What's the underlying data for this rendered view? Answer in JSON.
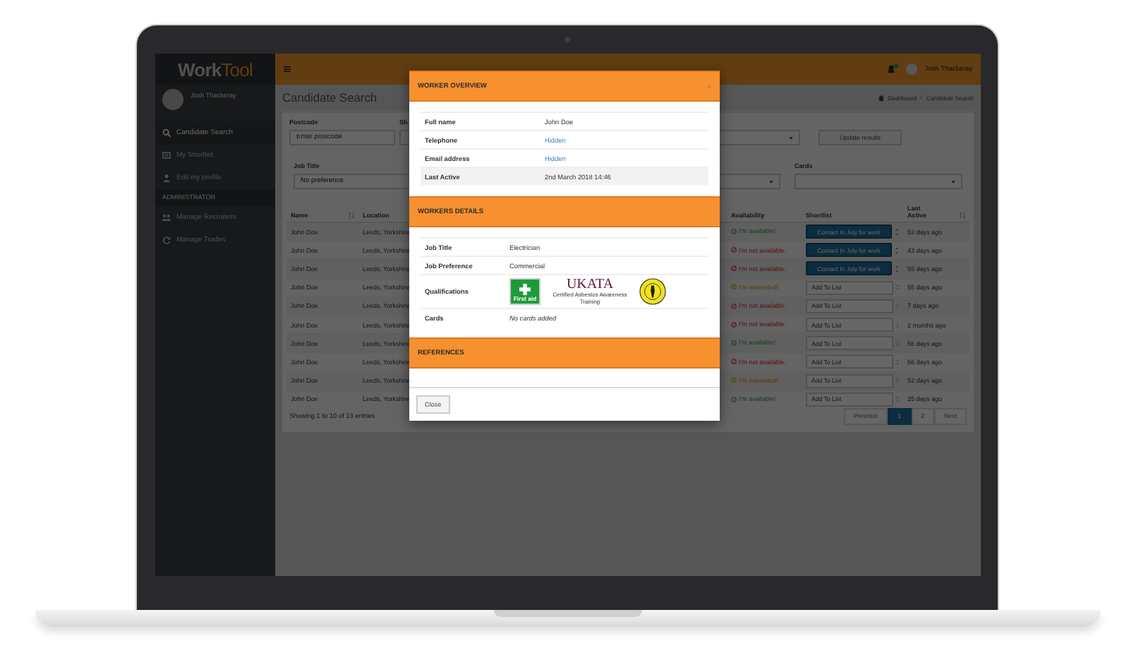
{
  "sidebar": {
    "logo": [
      "Work",
      "Tool"
    ],
    "user": "Josh Thackeray",
    "items": [
      {
        "kind": "search",
        "label": "Candidate Search",
        "selected": true
      },
      {
        "kind": "list",
        "label": "My Shortlist",
        "selected": false
      },
      {
        "kind": "user",
        "label": "Edit my profile",
        "selected": false
      }
    ],
    "section": "ADMINISTRATOR",
    "admin_items": [
      {
        "kind": "users",
        "label": "Manage Recruiters",
        "selected": false
      },
      {
        "kind": "refresh",
        "label": "Manage Trades",
        "selected": false
      }
    ]
  },
  "topbar": {
    "user": "Josh Thackeray"
  },
  "page": {
    "title": "Candidate Search",
    "breadcrumb": [
      "Dashboard",
      "Candidate Search"
    ],
    "filters": [
      {
        "label": "Postcode",
        "placeholder": "Enter postcode"
      },
      {
        "label": "Sh"
      }
    ],
    "update_button": "Update results",
    "job_title": {
      "label": "Job Title",
      "value": "No preference"
    },
    "cards": {
      "label": "Cards"
    }
  },
  "table": {
    "columns": [
      {
        "label": "Name",
        "sortable": true
      },
      {
        "label": "Location",
        "sortable": false
      },
      {
        "label": "Availability",
        "sortable": false
      },
      {
        "label": "Shortlist",
        "sortable": false
      },
      {
        "label": "Last Active",
        "sortable": true
      }
    ],
    "rows": [
      {
        "name": "John Doe",
        "location": "Leeds, Yorkshire",
        "availability": {
          "kind": "available",
          "text": "I'm available!"
        },
        "shortlist": {
          "kind": "tag",
          "text": "Contact In July for work"
        },
        "last_active": "53 days ago"
      },
      {
        "name": "John Doe",
        "location": "Leeds, Yorkshire",
        "availability": {
          "kind": "unavailable",
          "text": "I'm not available."
        },
        "shortlist": {
          "kind": "tag",
          "text": "Contact In July for work"
        },
        "last_active": "43 days ago"
      },
      {
        "name": "John Doe",
        "location": "Leeds, Yorkshire",
        "availability": {
          "kind": "unavailable",
          "text": "I'm not available."
        },
        "shortlist": {
          "kind": "tag",
          "text": "Contact In July for work"
        },
        "last_active": "55 days ago"
      },
      {
        "name": "John Doe",
        "location": "Leeds, Yorkshire",
        "availability": {
          "kind": "interested",
          "text": "I'm interested!"
        },
        "shortlist": {
          "kind": "field",
          "placeholder": "Add To List"
        },
        "last_active": "55 days ago"
      },
      {
        "name": "John Doe",
        "location": "Leeds, Yorkshire",
        "availability": {
          "kind": "unavailable",
          "text": "I'm not available."
        },
        "shortlist": {
          "kind": "field",
          "placeholder": "Add To List"
        },
        "last_active": "7 days ago"
      },
      {
        "name": "John Doe",
        "location": "Leeds, Yorkshire",
        "availability": {
          "kind": "unavailable",
          "text": "I'm not available."
        },
        "shortlist": {
          "kind": "field",
          "placeholder": "Add To List"
        },
        "last_active": "2 months ago"
      },
      {
        "name": "John Doe",
        "location": "Leeds, Yorkshire",
        "availability": {
          "kind": "available",
          "text": "I'm available!"
        },
        "shortlist": {
          "kind": "field",
          "placeholder": "Add To List"
        },
        "last_active": "56 days ago"
      },
      {
        "name": "John Doe",
        "location": "Leeds, Yorkshire",
        "availability": {
          "kind": "unavailable",
          "text": "I'm not available."
        },
        "shortlist": {
          "kind": "field",
          "placeholder": "Add To List"
        },
        "last_active": "56 days ago"
      },
      {
        "name": "John Doe",
        "location": "Leeds, Yorkshire",
        "availability": {
          "kind": "interested",
          "text": "I'm interested!"
        },
        "shortlist": {
          "kind": "field",
          "placeholder": "Add To List"
        },
        "last_active": "52 days ago"
      },
      {
        "name": "John Doe",
        "location": "Leeds, Yorkshire",
        "availability": {
          "kind": "available",
          "text": "I'm available!"
        },
        "shortlist": {
          "kind": "field",
          "placeholder": "Add To List"
        },
        "last_active": "25 days ago"
      }
    ],
    "info": "Showing 1 to 10 of 13 entries",
    "pagination": [
      {
        "label": "Previous",
        "selected": false
      },
      {
        "label": "1",
        "selected": true
      },
      {
        "label": "2",
        "selected": false
      },
      {
        "label": "Next",
        "selected": false
      }
    ]
  },
  "modal": {
    "sections": [
      {
        "title": "WORKER OVERVIEW",
        "rows": [
          {
            "label": "Full name",
            "kind": "text",
            "value": "John Doe",
            "highlighted": false
          },
          {
            "label": "Telephone",
            "kind": "link",
            "value": "Hidden",
            "highlighted": false
          },
          {
            "label": "Email address",
            "kind": "link",
            "value": "Hidden",
            "highlighted": false
          },
          {
            "label": "Last Active",
            "kind": "text",
            "value": "2nd March 2018 14:46",
            "highlighted": true
          }
        ]
      },
      {
        "title": "WORKERS DETAILS",
        "rows": [
          {
            "label": "Job Title",
            "kind": "text",
            "value": "Electrician",
            "highlighted": false
          },
          {
            "label": "Job Preference",
            "kind": "text",
            "value": "Commercial",
            "highlighted": false
          },
          {
            "label": "Qualifications",
            "kind": "badges",
            "badges": [
              {
                "kind": "first-aid",
                "label": "First aid"
              },
              {
                "kind": "ukata",
                "title": "UKATA",
                "caption": "Certified Asbestos Awareness Training"
              },
              {
                "kind": "seal"
              }
            ],
            "highlighted": false
          },
          {
            "label": "Cards",
            "kind": "empty",
            "value": "No cards added",
            "highlighted": false
          }
        ]
      },
      {
        "title": "REFERENCES"
      }
    ],
    "close_button": "Close"
  }
}
